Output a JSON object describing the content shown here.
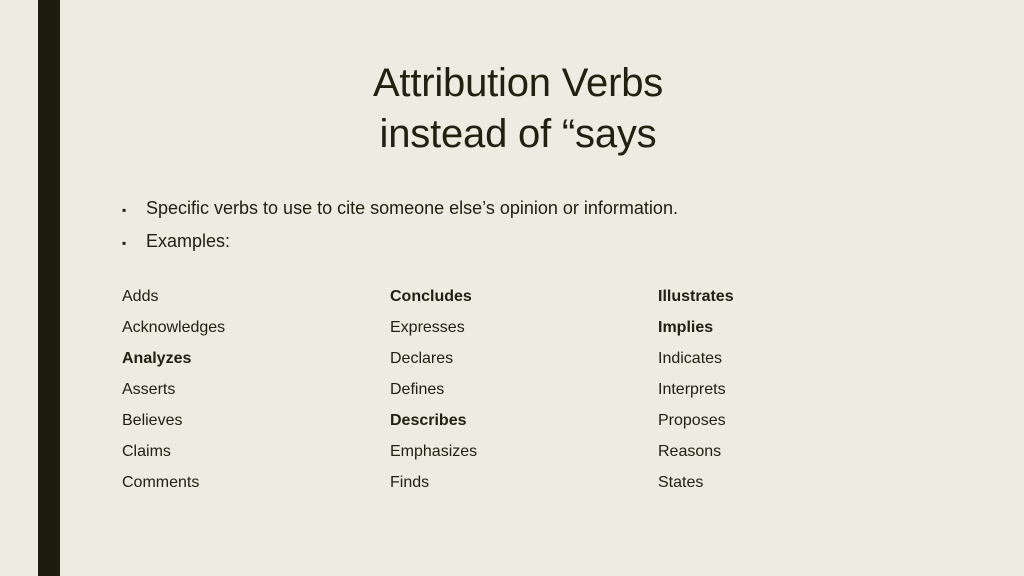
{
  "slide": {
    "background_color": "#EEEBE3",
    "accent_bar_color": "#1B1C0E",
    "text_color": "#21210F",
    "title_line1": "Attribution Verbs",
    "title_line2": "instead of “says"
  },
  "bullets": [
    {
      "marker": "▪",
      "text": "Specific verbs to use to cite someone else’s opinion or information."
    },
    {
      "marker": "▪",
      "text": "Examples:"
    }
  ],
  "verb_columns": [
    {
      "name": "column-1",
      "items": [
        {
          "label": "Adds",
          "bold": false
        },
        {
          "label": "Acknowledges",
          "bold": false
        },
        {
          "label": "Analyzes",
          "bold": true
        },
        {
          "label": "Asserts",
          "bold": false
        },
        {
          "label": "Believes",
          "bold": false
        },
        {
          "label": "Claims",
          "bold": false
        },
        {
          "label": "Comments",
          "bold": false
        }
      ]
    },
    {
      "name": "column-2",
      "items": [
        {
          "label": "Concludes",
          "bold": true
        },
        {
          "label": "Expresses",
          "bold": false
        },
        {
          "label": "Declares",
          "bold": false
        },
        {
          "label": "Defines",
          "bold": false
        },
        {
          "label": "Describes",
          "bold": true
        },
        {
          "label": "Emphasizes",
          "bold": false
        },
        {
          "label": "Finds",
          "bold": false
        }
      ]
    },
    {
      "name": "column-3",
      "items": [
        {
          "label": "Illustrates",
          "bold": true
        },
        {
          "label": "Implies",
          "bold": true
        },
        {
          "label": "Indicates",
          "bold": false
        },
        {
          "label": "Interprets",
          "bold": false
        },
        {
          "label": "Proposes",
          "bold": false
        },
        {
          "label": "Reasons",
          "bold": false
        },
        {
          "label": "States",
          "bold": false
        }
      ]
    }
  ]
}
